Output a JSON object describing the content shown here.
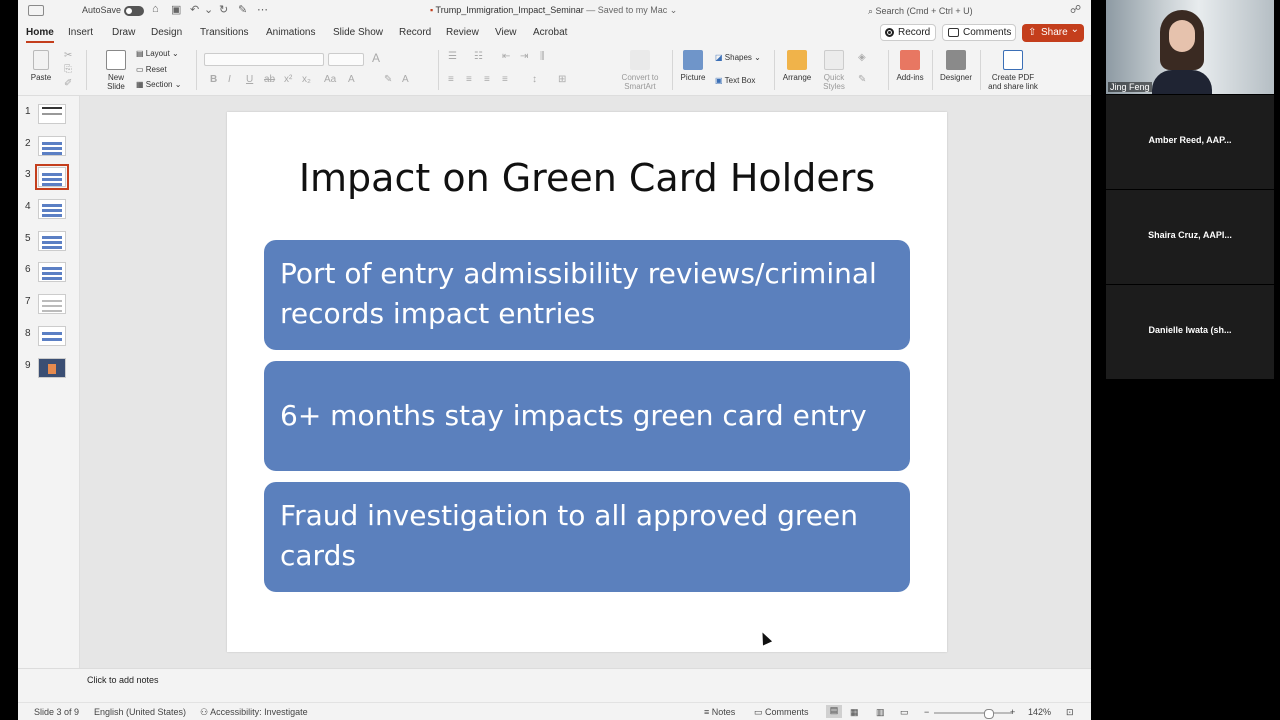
{
  "titlebar": {
    "autosave_label": "AutoSave",
    "doc_title": "Trump_Immigration_Impact_Seminar",
    "saved_status": "— Saved to my Mac",
    "search_placeholder": "Search (Cmd + Ctrl + U)"
  },
  "tabs": [
    "Home",
    "Insert",
    "Draw",
    "Design",
    "Transitions",
    "Animations",
    "Slide Show",
    "Record",
    "Review",
    "View",
    "Acrobat"
  ],
  "actions": {
    "record": "Record",
    "comments": "Comments",
    "share": "Share"
  },
  "ribbon": {
    "paste": "Paste",
    "new_slide_line1": "New",
    "new_slide_line2": "Slide",
    "layout": "Layout",
    "reset": "Reset",
    "section": "Section",
    "convert_line1": "Convert to",
    "convert_line2": "SmartArt",
    "picture": "Picture",
    "shapes": "Shapes",
    "text_box": "Text Box",
    "arrange": "Arrange",
    "quick_styles_line1": "Quick",
    "quick_styles_line2": "Styles",
    "addins": "Add-ins",
    "designer": "Designer",
    "create_pdf_line1": "Create PDF",
    "create_pdf_line2": "and share link"
  },
  "slides": [
    "1",
    "2",
    "3",
    "4",
    "5",
    "6",
    "7",
    "8",
    "9"
  ],
  "current_slide": {
    "title": "Impact on Green Card Holders",
    "bullets": [
      "Port of entry admissibility reviews/criminal records impact entries",
      "6+ months stay impacts green card entry",
      "Fraud investigation to all approved green cards"
    ]
  },
  "notes_placeholder": "Click to add notes",
  "status": {
    "slide_indicator": "Slide 3 of 9",
    "language": "English (United States)",
    "accessibility": "Accessibility: Investigate",
    "notes": "Notes",
    "comments": "Comments",
    "zoom": "142%"
  },
  "participants": [
    {
      "name": "Jing Feng",
      "video": true
    },
    {
      "name": "Amber Reed, AAP...",
      "video": false
    },
    {
      "name": "Shaira Cruz, AAPI...",
      "video": false
    },
    {
      "name": "Danielle Iwata (sh...",
      "video": false
    }
  ],
  "colors": {
    "accent": "#c43e1c",
    "card": "#5b80bd"
  }
}
